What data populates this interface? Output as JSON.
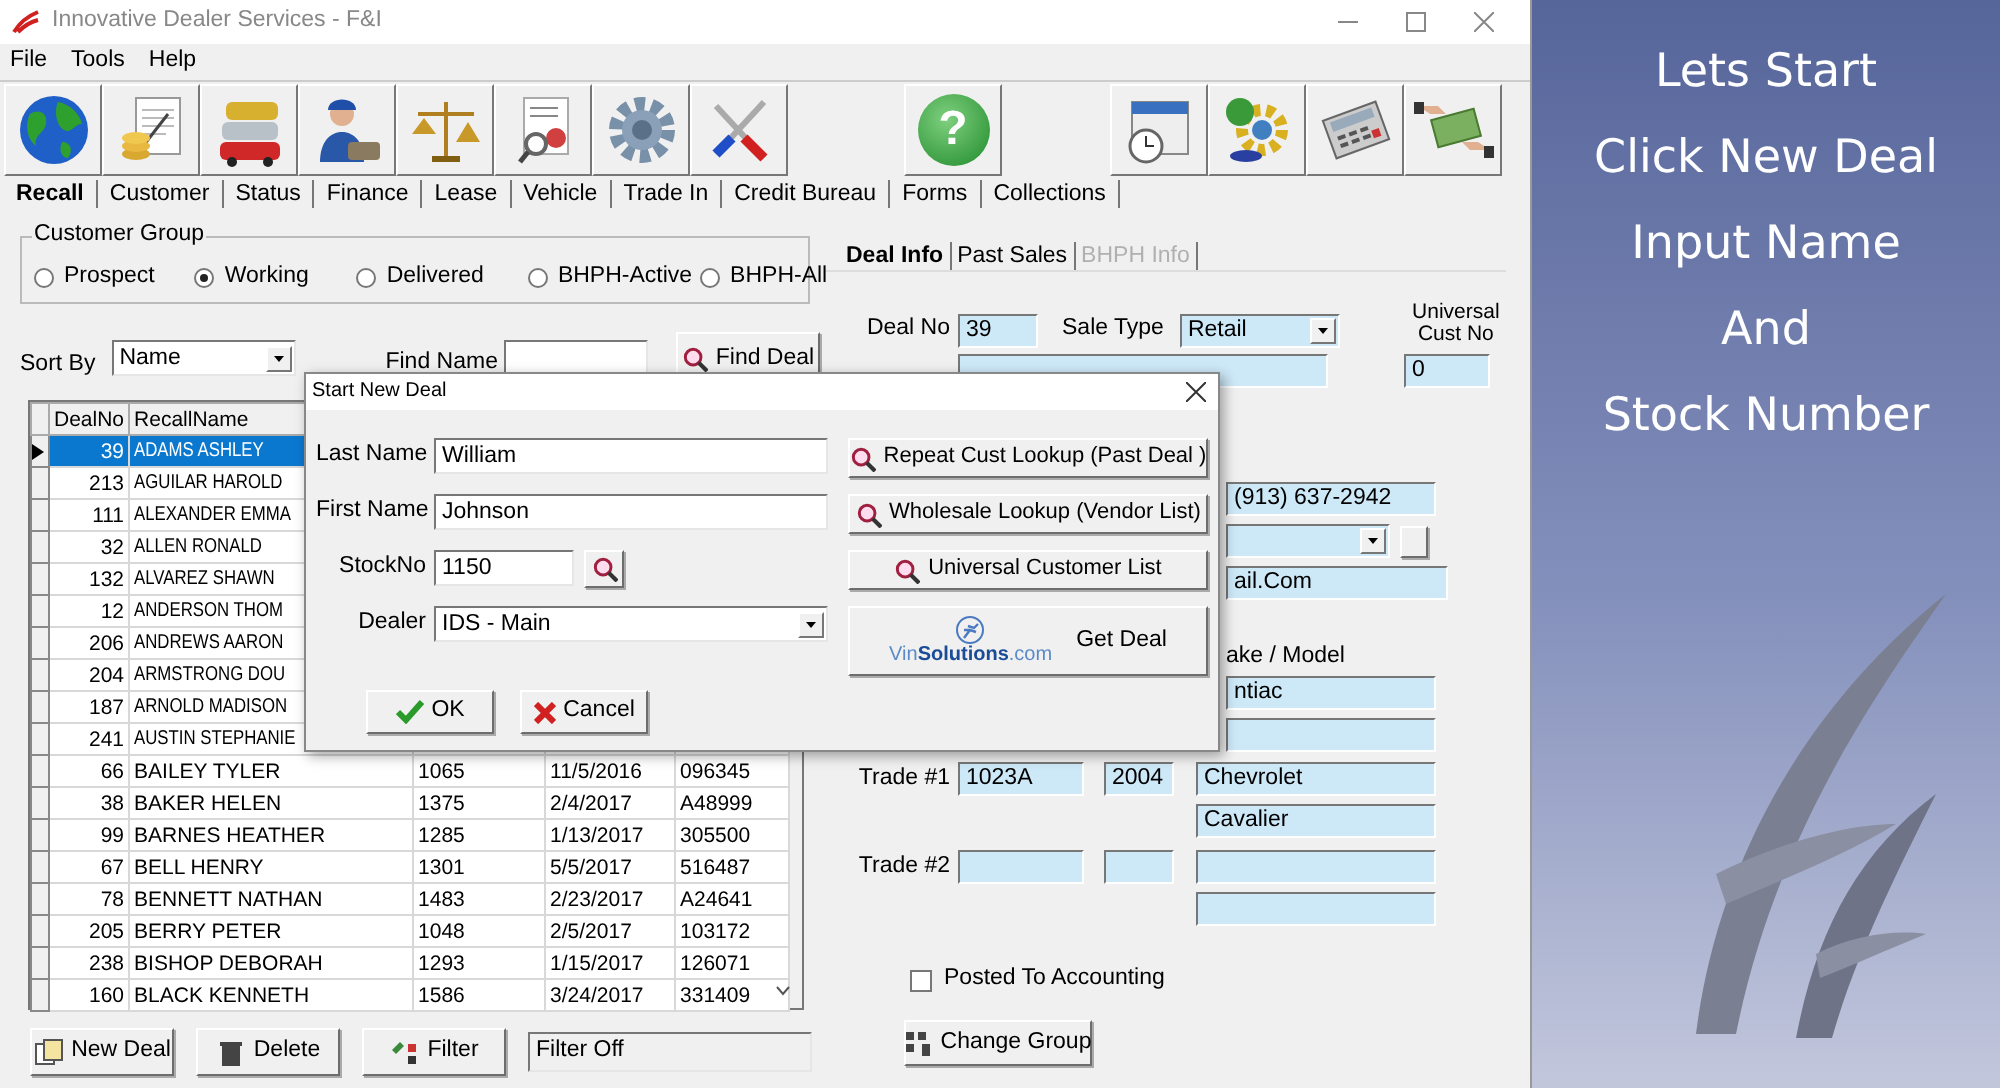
{
  "window": {
    "title": "Innovative Dealer Services - F&I"
  },
  "menu": [
    "File",
    "Tools",
    "Help"
  ],
  "help_button": {
    "glyph": "?"
  },
  "tabs": [
    {
      "label": "Recall",
      "selected": true
    },
    {
      "label": "Customer",
      "selected": false
    },
    {
      "label": "Status",
      "selected": false
    },
    {
      "label": "Finance",
      "selected": false
    },
    {
      "label": "Lease",
      "selected": false
    },
    {
      "label": "Vehicle",
      "selected": false
    },
    {
      "label": "Trade In",
      "selected": false
    },
    {
      "label": "Credit Bureau",
      "selected": false
    },
    {
      "label": "Forms",
      "selected": false
    },
    {
      "label": "Collections",
      "selected": false
    }
  ],
  "customer_group": {
    "title": "Customer Group",
    "options": [
      {
        "label": "Prospect",
        "selected": false
      },
      {
        "label": "Working",
        "selected": true
      },
      {
        "label": "Delivered",
        "selected": false
      },
      {
        "label": "BHPH-Active",
        "selected": false
      },
      {
        "label": "BHPH-All",
        "selected": false
      }
    ]
  },
  "sort_by": {
    "label": "Sort By",
    "value": "Name"
  },
  "find_name": {
    "label": "Find Name"
  },
  "find_deal_button": "Find Deal",
  "grid": {
    "columns": [
      "DealNo",
      "RecallName"
    ],
    "rows": [
      {
        "cells": [
          "39",
          "ADAMS ASHLEY"
        ],
        "selected": true
      },
      {
        "cells": [
          "213",
          "AGUILAR HAROLD"
        ],
        "selected": false
      },
      {
        "cells": [
          "111",
          "ALEXANDER EMMA"
        ],
        "selected": false
      },
      {
        "cells": [
          "32",
          "ALLEN RONALD"
        ],
        "selected": false
      },
      {
        "cells": [
          "132",
          "ALVAREZ SHAWN"
        ],
        "selected": false
      },
      {
        "cells": [
          "12",
          "ANDERSON THOM"
        ],
        "selected": false
      },
      {
        "cells": [
          "206",
          "ANDREWS AARON"
        ],
        "selected": false
      },
      {
        "cells": [
          "204",
          "ARMSTRONG DOU"
        ],
        "selected": false
      },
      {
        "cells": [
          "187",
          "ARNOLD MADISON"
        ],
        "selected": false
      },
      {
        "cells": [
          "241",
          "AUSTIN STEPHANIE"
        ],
        "selected": false
      },
      {
        "cells": [
          "66",
          "BAILEY TYLER",
          "1065",
          "11/5/2016",
          "096345"
        ],
        "selected": false
      },
      {
        "cells": [
          "38",
          "BAKER HELEN",
          "1375",
          "2/4/2017",
          "A48999"
        ],
        "selected": false
      },
      {
        "cells": [
          "99",
          "BARNES HEATHER",
          "1285",
          "1/13/2017",
          "305500"
        ],
        "selected": false
      },
      {
        "cells": [
          "67",
          "BELL HENRY",
          "1301",
          "5/5/2017",
          "516487"
        ],
        "selected": false
      },
      {
        "cells": [
          "78",
          "BENNETT NATHAN",
          "1483",
          "2/23/2017",
          "A24641"
        ],
        "selected": false
      },
      {
        "cells": [
          "205",
          "BERRY PETER",
          "1048",
          "2/5/2017",
          "103172"
        ],
        "selected": false
      },
      {
        "cells": [
          "238",
          "BISHOP DEBORAH",
          "1293",
          "1/15/2017",
          "126071"
        ],
        "selected": false
      },
      {
        "cells": [
          "160",
          "BLACK KENNETH",
          "1586",
          "3/24/2017",
          "331409"
        ],
        "selected": false
      }
    ]
  },
  "grid_buttons": [
    "New Deal",
    "Delete",
    "Filter"
  ],
  "filter_status": "Filter Off",
  "detail_tabs": [
    {
      "label": "Deal Info",
      "selected": true,
      "disabled": false
    },
    {
      "label": "Past Sales",
      "selected": false,
      "disabled": false
    },
    {
      "label": "BHPH Info",
      "selected": false,
      "disabled": true
    }
  ],
  "deal": {
    "deal_no_label": "Deal No",
    "deal_no": "39",
    "sale_type_label": "Sale Type",
    "sale_type": "Retail",
    "universal_cust_no_label": "Universal Cust No",
    "universal_cust_no": "0",
    "phone": "(913) 637-2942",
    "email": "ail.Com",
    "vehicle_label": "ake / Model",
    "vehicle_make": "ntiac"
  },
  "trades": [
    {
      "label": "Trade #1",
      "stock_no": "1023A",
      "year": "2004",
      "make": "Chevrolet",
      "model": "Cavalier"
    },
    {
      "label": "Trade #2"
    }
  ],
  "posted_to_accounting": {
    "label": "Posted To Accounting",
    "checked": false
  },
  "change_group_button": "Change Group",
  "dialog": {
    "title": "Start New Deal",
    "last_name": {
      "label": "Last Name",
      "value": "William"
    },
    "first_name": {
      "label": "First Name",
      "value": "Johnson"
    },
    "stock_no": {
      "label": "StockNo",
      "value": "1150"
    },
    "dealer": {
      "label": "Dealer",
      "value": "IDS - Main"
    },
    "lookup_buttons": [
      "Repeat Cust Lookup (Past Deal )",
      "Wholesale Lookup (Vendor List)",
      "Universal Customer List"
    ],
    "vinsolutions": {
      "logo": "Vin**Solutions**.com",
      "label": "Get Deal"
    },
    "ok_button": "OK",
    "cancel_button": "Cancel"
  },
  "banner": {
    "lines": [
      "Lets Start",
      "Click New Deal",
      "Input Name",
      "And",
      "Stock Number"
    ]
  }
}
